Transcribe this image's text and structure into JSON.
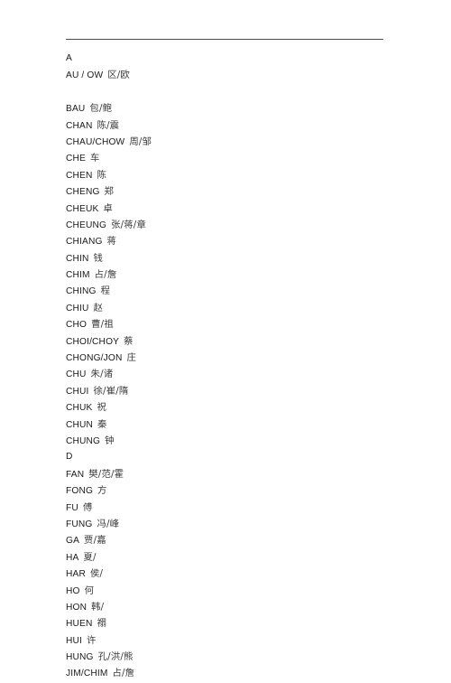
{
  "document": {
    "has_horizontal_rule": true,
    "rule_color": "#4a4a4a",
    "background": "#ffffff",
    "text_color": "#1a1a1a",
    "han_color": "#3b3b3b"
  },
  "lines": [
    {
      "kind": "section",
      "roman": "A",
      "han": ""
    },
    {
      "kind": "entry",
      "roman": "AU / OW",
      "han": "区/欧"
    },
    {
      "kind": "blank",
      "roman": "",
      "han": ""
    },
    {
      "kind": "entry",
      "roman": "BAU",
      "han": "包/鲍"
    },
    {
      "kind": "entry",
      "roman": "CHAN",
      "han": "陈/震"
    },
    {
      "kind": "entry",
      "roman": "CHAU/CHOW",
      "han": "周/邹"
    },
    {
      "kind": "entry",
      "roman": "CHE",
      "han": "车"
    },
    {
      "kind": "entry",
      "roman": "CHEN",
      "han": "陈"
    },
    {
      "kind": "entry",
      "roman": "CHENG",
      "han": "郑"
    },
    {
      "kind": "entry",
      "roman": "CHEUK",
      "han": "卓"
    },
    {
      "kind": "entry",
      "roman": "CHEUNG",
      "han": "张/蒋/章"
    },
    {
      "kind": "entry",
      "roman": "CHIANG",
      "han": "蒋"
    },
    {
      "kind": "entry",
      "roman": "CHIN",
      "han": "钱"
    },
    {
      "kind": "entry",
      "roman": "CHIM",
      "han": "占/詹"
    },
    {
      "kind": "entry",
      "roman": "CHING",
      "han": "程"
    },
    {
      "kind": "entry",
      "roman": "CHIU",
      "han": "赵"
    },
    {
      "kind": "entry",
      "roman": "CHO",
      "han": "曹/祖"
    },
    {
      "kind": "entry",
      "roman": "CHOI/CHOY",
      "han": "蔡"
    },
    {
      "kind": "entry",
      "roman": "CHONG/JON",
      "han": "庄"
    },
    {
      "kind": "entry",
      "roman": "CHU",
      "han": "朱/诸"
    },
    {
      "kind": "entry",
      "roman": "CHUI",
      "han": "徐/崔/隋"
    },
    {
      "kind": "entry",
      "roman": "CHUK",
      "han": "祝"
    },
    {
      "kind": "entry",
      "roman": "CHUN",
      "han": "秦"
    },
    {
      "kind": "entry",
      "roman": "CHUNG",
      "han": "钟"
    },
    {
      "kind": "section",
      "roman": "D",
      "han": ""
    },
    {
      "kind": "entry",
      "roman": "FAN",
      "han": "樊/范/霍"
    },
    {
      "kind": "entry",
      "roman": "FONG",
      "han": "方"
    },
    {
      "kind": "entry",
      "roman": "FU",
      "han": "傅"
    },
    {
      "kind": "entry",
      "roman": "FUNG",
      "han": "冯/峰"
    },
    {
      "kind": "entry",
      "roman": "GA",
      "han": "贾/嘉"
    },
    {
      "kind": "entry",
      "roman": "HA",
      "han": "夏/"
    },
    {
      "kind": "entry",
      "roman": "HAR",
      "han": "侯/"
    },
    {
      "kind": "entry",
      "roman": "HO",
      "han": "何"
    },
    {
      "kind": "entry",
      "roman": "HON",
      "han": "韩/"
    },
    {
      "kind": "entry",
      "roman": "HUEN",
      "han": "禤"
    },
    {
      "kind": "entry",
      "roman": "HUI",
      "han": "许"
    },
    {
      "kind": "entry",
      "roman": "HUNG",
      "han": "孔/洪/熊"
    },
    {
      "kind": "entry",
      "roman": "JIM/CHIM",
      "han": "占/詹"
    }
  ]
}
